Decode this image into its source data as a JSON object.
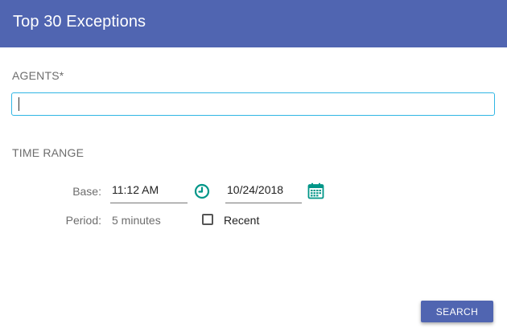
{
  "dialog": {
    "title": "Top 30 Exceptions"
  },
  "agents": {
    "label": "AGENTS*",
    "value": ""
  },
  "time_range": {
    "label": "TIME RANGE",
    "base_label": "Base:",
    "base_time": "11:12 AM",
    "base_date": "10/24/2018",
    "period_label": "Period:",
    "period_value": "5 minutes",
    "recent_label": "Recent",
    "recent_checked": false
  },
  "actions": {
    "search_label": "SEARCH"
  },
  "icons": {
    "time_picker": "clock-icon",
    "date_picker": "calendar-icon"
  },
  "colors": {
    "primary": "#5065b1",
    "accent": "#009688",
    "input_focus": "#30b6e4"
  }
}
